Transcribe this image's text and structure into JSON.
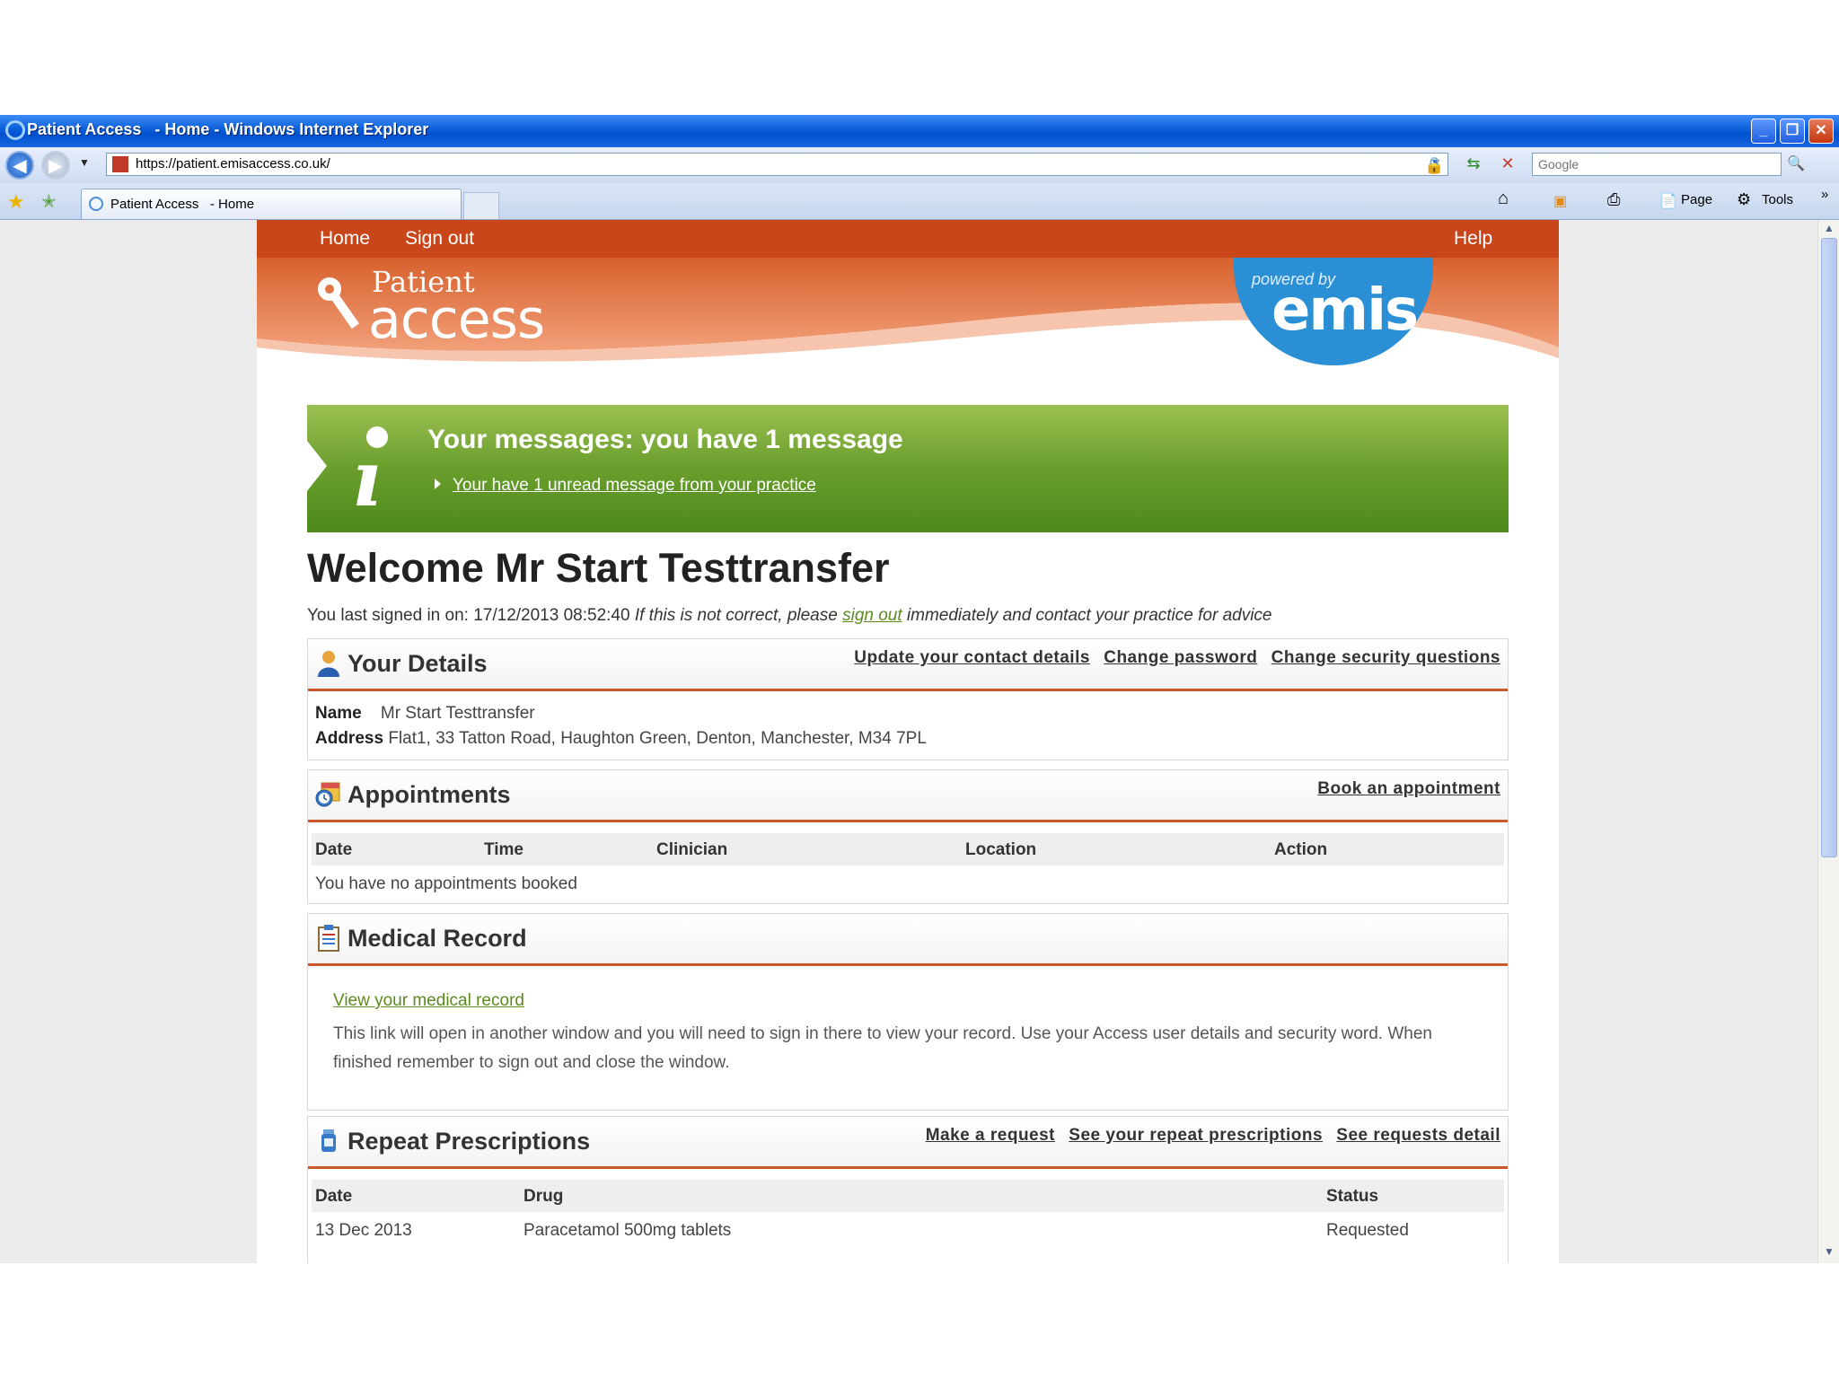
{
  "window": {
    "title": "Patient Access   - Home - Windows Internet Explorer",
    "buttons": {
      "minimize": "_",
      "maximize": "❐",
      "close": "✕"
    }
  },
  "addressbar": {
    "url": "https://patient.emisaccess.co.uk/",
    "search_placeholder": "Google"
  },
  "tabbar": {
    "tab_title": "Patient Access   - Home",
    "page_label": "Page",
    "tools_label": "Tools"
  },
  "nav": {
    "home": "Home",
    "signout": "Sign out",
    "help": "Help"
  },
  "brand": {
    "patient": "Patient",
    "access": "access",
    "powered_by": "powered by",
    "emis": "emis"
  },
  "messages": {
    "title": "Your messages: you have 1 message",
    "link": "Your have 1 unread message from your practice"
  },
  "welcome": {
    "heading": "Welcome Mr Start Testtransfer",
    "last_signed_prefix": "You last signed in on: 17/12/2013 08:52:40 ",
    "warning_before": "If this is not correct, please ",
    "signout_link": "sign out",
    "warning_after": " immediately and contact your practice for advice"
  },
  "details": {
    "title": "Your Details",
    "links": [
      "Update your contact details",
      "Change password",
      "Change security questions"
    ],
    "name_label": "Name",
    "name_value": "Mr Start Testtransfer",
    "address_label": "Address",
    "address_value": "Flat1, 33 Tatton Road, Haughton Green, Denton, Manchester, M34 7PL"
  },
  "appointments": {
    "title": "Appointments",
    "link": "Book an appointment",
    "columns": [
      "Date",
      "Time",
      "Clinician",
      "Location",
      "Action"
    ],
    "empty": "You have no appointments booked"
  },
  "medical": {
    "title": "Medical Record",
    "link": "View your medical record",
    "text": "This link will open in another window and you will need to sign in there to view your record. Use your Access user details and security word. When finished remember to sign out and close the window."
  },
  "prescriptions": {
    "title": "Repeat Prescriptions",
    "links": [
      "Make a request",
      "See your repeat prescriptions",
      "See requests detail"
    ],
    "columns": [
      "Date",
      "Drug",
      "Status"
    ],
    "rows": [
      {
        "date": "13 Dec 2013",
        "drug": "Paracetamol 500mg tablets",
        "status": "Requested"
      }
    ]
  },
  "colors": {
    "nav_bar": "#c9461a",
    "message_green": "#6a9e2c",
    "link_green": "#5c8a1e",
    "emis_blue": "#2a8fd4",
    "ie_blue": "#0a5fd8"
  }
}
